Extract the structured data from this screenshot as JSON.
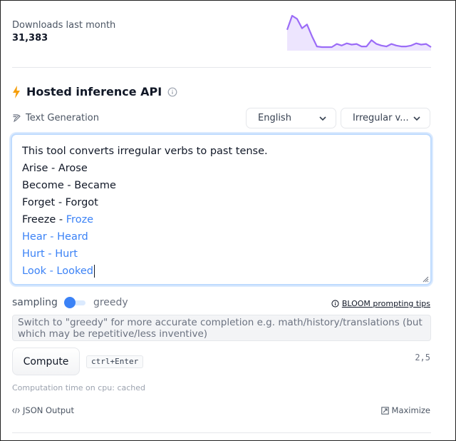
{
  "downloads": {
    "label": "Downloads last month",
    "count": "31,383",
    "sparkline": [
      0.55,
      1.0,
      0.9,
      0.6,
      0.72,
      0.35,
      0.02,
      0.0,
      0.0,
      0.0,
      0.1,
      0.05,
      0.12,
      0.08,
      0.1,
      0.02,
      0.02,
      0.22,
      0.1,
      0.05,
      0.02,
      0.1,
      0.05,
      0.02,
      0.02,
      0.05,
      0.12,
      0.08,
      0.1,
      0.0
    ],
    "color": "#9b6cf7"
  },
  "inference": {
    "title": "Hosted inference API",
    "task": "Text Generation",
    "language": "English",
    "example": "Irregular v..."
  },
  "editor": {
    "prompt_lines": [
      "This tool converts irregular verbs to past tense.",
      "Arise - Arose",
      "Become - Became",
      "Forget - Forgot"
    ],
    "mixed_prefix": "Freeze - ",
    "mixed_generated": "Froze",
    "generated_lines": [
      "Hear - Heard",
      "Hurt - Hurt",
      "Look - Looked"
    ]
  },
  "sampling": {
    "left_label": "sampling",
    "right_label": "greedy",
    "tips": "BLOOM prompting tips",
    "hint": "Switch to \"greedy\" for more accurate completion e.g. math/history/translations (but which may be repetitive/less inventive)"
  },
  "compute": {
    "button": "Compute",
    "shortcut": "ctrl+Enter",
    "counter": "2,5",
    "time": "Computation time on cpu: cached"
  },
  "footer": {
    "json": "JSON Output",
    "maximize": "Maximize"
  },
  "colors": {
    "accent": "#3b82f6",
    "bolt": "#f59e0b"
  }
}
